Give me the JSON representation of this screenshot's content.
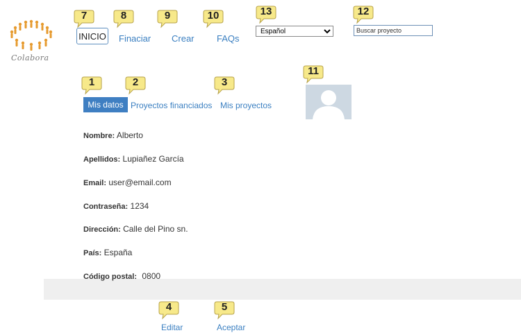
{
  "logo": {
    "text": "Colabora"
  },
  "nav": {
    "inicio": "INICIO",
    "financiar": "Finaciar",
    "crear": "Crear",
    "faqs": "FAQs"
  },
  "language": {
    "selected": "Español"
  },
  "search": {
    "value": "Buscar proyecto"
  },
  "tabs": {
    "mis_datos": "Mis datos",
    "financiados": "Proyectos financiados",
    "mis_proyectos": "Mis proyectos"
  },
  "profile": {
    "nombre": {
      "label": "Nombre:",
      "value": "Alberto"
    },
    "apellidos": {
      "label": "Apellidos:",
      "value": "Lupiañez García"
    },
    "email": {
      "label": "Email:",
      "value": "user@email.com"
    },
    "contrasena": {
      "label": "Contraseña:",
      "value": "1234"
    },
    "direccion": {
      "label": "Dirección:",
      "value": "Calle del Pino sn."
    },
    "pais": {
      "label": "País:",
      "value": "España"
    },
    "codigo_postal": {
      "label": "Código postal:",
      "value": "0800"
    }
  },
  "actions": {
    "editar": "Editar",
    "aceptar": "Aceptar"
  },
  "callouts": [
    "1",
    "2",
    "3",
    "4",
    "5",
    "7",
    "8",
    "9",
    "10",
    "11",
    "12",
    "13"
  ],
  "colors": {
    "accent": "#3f7fc2",
    "link": "#3a7fc1",
    "callout": "#f7e98a",
    "logo": "#e69a2e"
  }
}
